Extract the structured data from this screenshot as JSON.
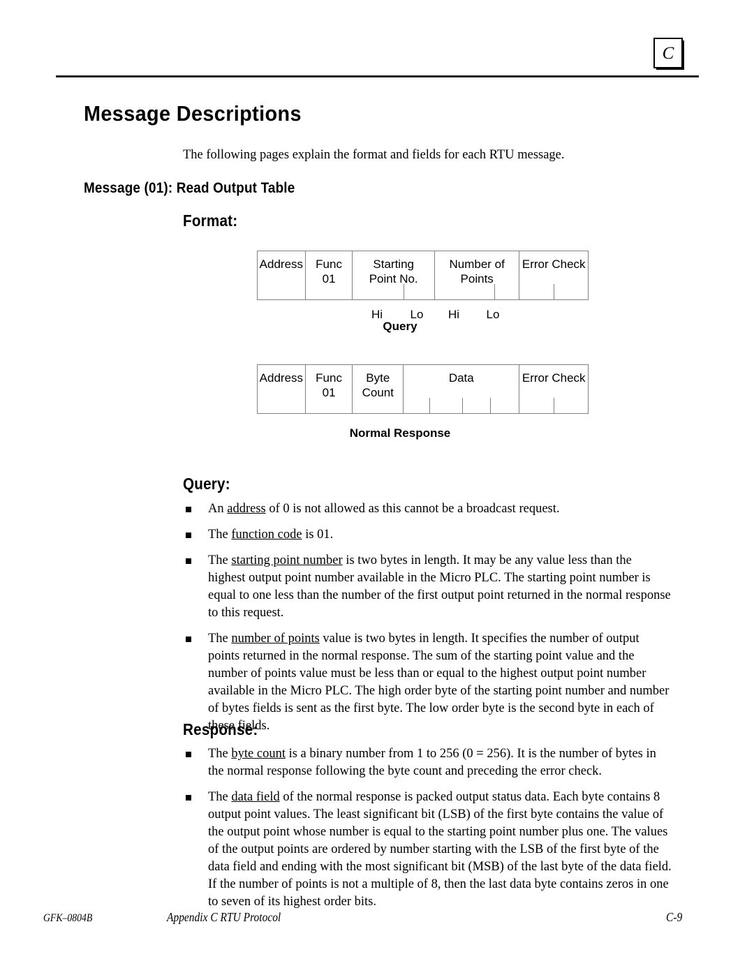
{
  "page": {
    "tab_marker": "C"
  },
  "headings": {
    "title": "Message Descriptions",
    "message_heading": "Message  (01):  Read Output Table",
    "format": "Format:",
    "query": "Query:",
    "response": "Response:"
  },
  "intro": "The following pages explain the format and fields for each RTU message.",
  "diagrams": [
    {
      "name": "query-frame",
      "caption": "Query",
      "cells": [
        {
          "lines": [
            "Address"
          ],
          "ticks": 0
        },
        {
          "lines": [
            "Func",
            "01"
          ],
          "ticks": 0
        },
        {
          "lines": [
            "Starting",
            "Point No."
          ],
          "ticks": 1
        },
        {
          "lines": [
            "Number of",
            "Points"
          ],
          "ticks": 1
        },
        {
          "lines": [
            "Error Check"
          ],
          "ticks": 1
        }
      ],
      "sublabels": [
        "Hi",
        "Lo",
        "Hi",
        "Lo"
      ]
    },
    {
      "name": "normal-response-frame",
      "caption": "Normal Response",
      "cells": [
        {
          "lines": [
            "Address"
          ],
          "ticks": 0
        },
        {
          "lines": [
            "Func",
            "01"
          ],
          "ticks": 0
        },
        {
          "lines": [
            "Byte",
            "Count"
          ],
          "ticks": 0
        },
        {
          "lines": [
            "Data"
          ],
          "ticks": 3
        },
        {
          "lines": [
            "Error Check"
          ],
          "ticks": 1
        }
      ],
      "sublabels": []
    }
  ],
  "query_bullets": [
    "An address of 0 is not allowed as this cannot be a broadcast request.",
    "The function code is 01.",
    "The starting point number is two bytes in length. It may be any value less than the highest output point number available in the Micro PLC.  The starting point number is equal to one less than the number of the first output point returned in the normal response to this request.",
    "The number of points value is two bytes in length.  It specifies the number of output points returned in the normal response.  The sum of the starting point value and the number of points value must be less than or equal to the highest output point number available in the Micro PLC.  The high order byte of the starting point number and number of bytes fields is sent as the first byte.  The low order byte is the second byte in each of these fields."
  ],
  "query_bullet_underlines": [
    "address",
    "function code",
    "starting point number",
    "number of points"
  ],
  "response_bullets": [
    "The byte count is a binary number from 1 to  256 (0 = 256).  It is the number of bytes in the normal response following  the byte count and preceding the error check.",
    "The data field of the normal response is packed output status data.  Each byte contains 8 output point values.  The least significant bit (LSB) of the first byte contains the value of the output point whose number is equal to the starting point number plus one.  The values of the output points are ordered by number starting with the LSB of the first byte of the data field and ending with the most significant bit (MSB) of the last byte of the data field.  If the number of points is not a multiple of 8, then the last data byte contains zeros in one to seven of its highest order bits."
  ],
  "response_bullet_underlines": [
    "byte count",
    "data field"
  ],
  "footer": {
    "left": "GFK–0804B",
    "center": "Appendix C RTU Protocol",
    "right": "C-9"
  }
}
